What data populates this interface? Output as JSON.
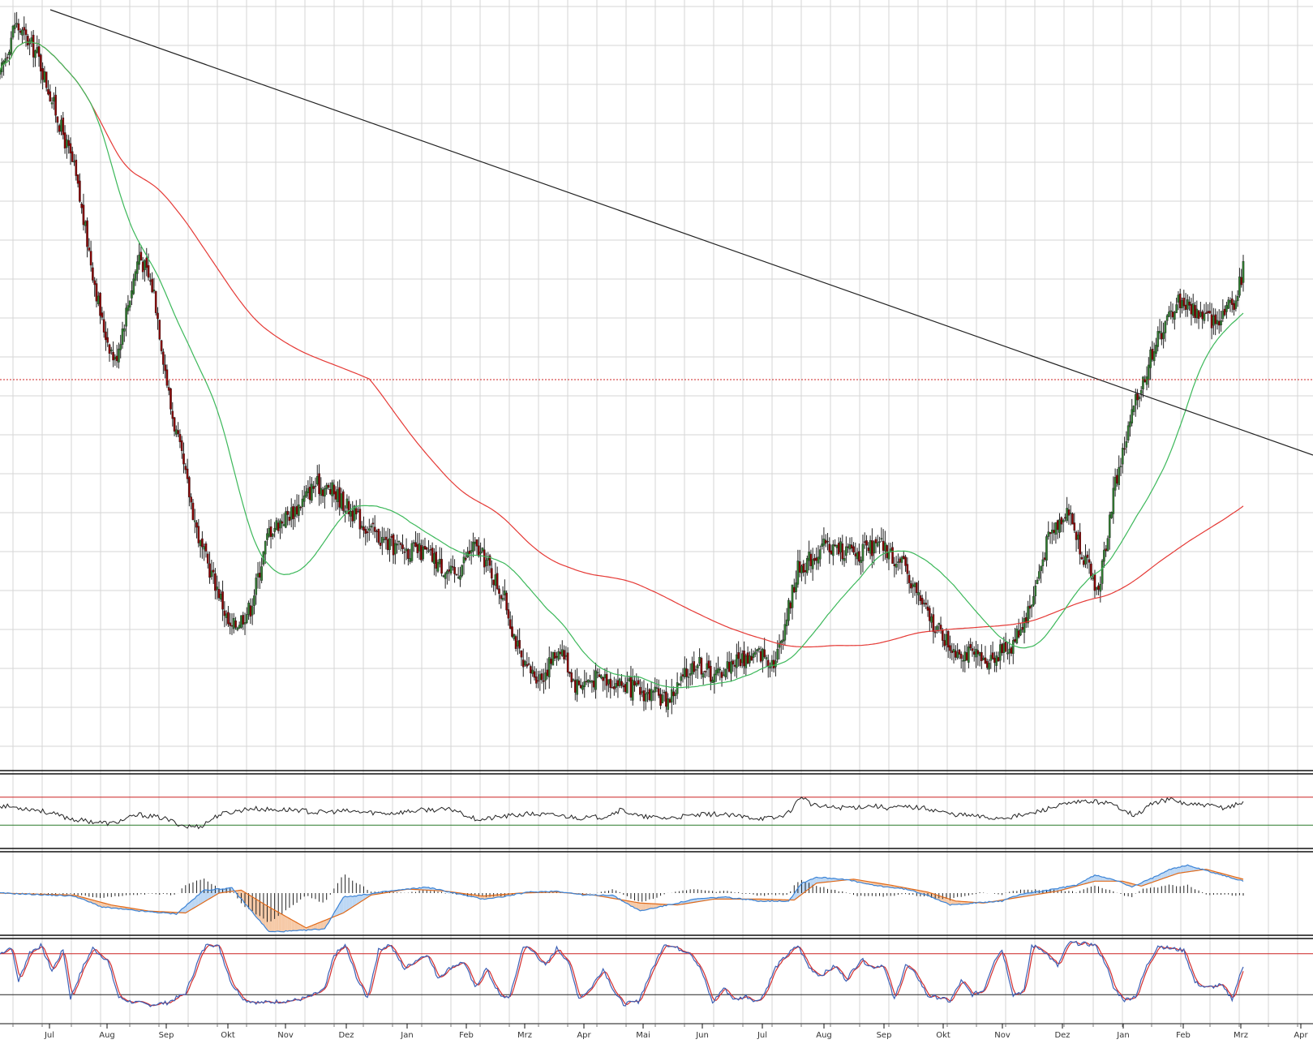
{
  "colors": {
    "grid": "#d6d6d6",
    "candle_up": "#2f7d2f",
    "candle_down": "#8b0000",
    "wick": "#222222",
    "sma_fast": "#3cb85a",
    "sma_slow": "#e53935",
    "trendline": "#222222",
    "level_line": "#cc2222",
    "rsi_line": "#222222",
    "overbought": "#cc2222",
    "oversold": "#2a7a2a",
    "macd_line": "#3b83d6",
    "signal_line": "#e06a1a",
    "macd_fill_pos": "#bcd7f4",
    "macd_fill_neg": "#f6c9a6",
    "histogram": "#222222",
    "stoch_k": "#3b5fb5",
    "stoch_d": "#d32f2f"
  },
  "chart_data": [
    {
      "type": "candlestick",
      "panel": "price",
      "x_ticks": [
        "Jul",
        "Aug",
        "Sep",
        "Okt",
        "Nov",
        "Dez",
        "Jan",
        "Feb",
        "Mrz",
        "Apr",
        "Mai",
        "Jun",
        "Jul",
        "Aug",
        "Sep",
        "Okt",
        "Nov",
        "Dez",
        "Jan",
        "Feb",
        "Mrz",
        "Apr"
      ],
      "ylim": [
        0,
        100
      ],
      "grid": true,
      "close_keypoints": [
        [
          0,
          90
        ],
        [
          8,
          97
        ],
        [
          20,
          93
        ],
        [
          40,
          78
        ],
        [
          55,
          58
        ],
        [
          62,
          53
        ],
        [
          75,
          67
        ],
        [
          83,
          62
        ],
        [
          92,
          47
        ],
        [
          100,
          38
        ],
        [
          108,
          29
        ],
        [
          118,
          23
        ],
        [
          124,
          18
        ],
        [
          135,
          21
        ],
        [
          145,
          31
        ],
        [
          160,
          34
        ],
        [
          170,
          37
        ],
        [
          180,
          36
        ],
        [
          195,
          32
        ],
        [
          210,
          29
        ],
        [
          230,
          28
        ],
        [
          245,
          25
        ],
        [
          255,
          29
        ],
        [
          262,
          27
        ],
        [
          272,
          22
        ],
        [
          282,
          13
        ],
        [
          292,
          12
        ],
        [
          302,
          16
        ],
        [
          310,
          11
        ],
        [
          325,
          12
        ],
        [
          345,
          10
        ],
        [
          360,
          9
        ],
        [
          375,
          14
        ],
        [
          385,
          12
        ],
        [
          395,
          14
        ],
        [
          410,
          15
        ],
        [
          418,
          14
        ],
        [
          430,
          26
        ],
        [
          445,
          29
        ],
        [
          462,
          28
        ],
        [
          475,
          29
        ],
        [
          488,
          26
        ],
        [
          500,
          20
        ],
        [
          512,
          16
        ],
        [
          530,
          14
        ],
        [
          545,
          16
        ],
        [
          555,
          21
        ],
        [
          565,
          30
        ],
        [
          575,
          34
        ],
        [
          585,
          27
        ],
        [
          592,
          23
        ],
        [
          600,
          36
        ],
        [
          610,
          46
        ],
        [
          622,
          55
        ],
        [
          635,
          61
        ],
        [
          648,
          59
        ],
        [
          655,
          58
        ],
        [
          660,
          60
        ],
        [
          666,
          61
        ],
        [
          670,
          65
        ]
      ],
      "sma_fast": "50-day moving average (green)",
      "sma_slow": "200-day moving average (red)",
      "trendline": "descending from the July high through the February highs",
      "horizontal_level": "dotted red resistance line near the latest high"
    },
    {
      "type": "line",
      "panel": "rsi",
      "ylim": [
        0,
        100
      ],
      "levels": [
        70,
        30
      ],
      "keypoints": [
        [
          0,
          58
        ],
        [
          20,
          52
        ],
        [
          40,
          38
        ],
        [
          60,
          32
        ],
        [
          75,
          45
        ],
        [
          88,
          40
        ],
        [
          100,
          28
        ],
        [
          108,
          28
        ],
        [
          118,
          45
        ],
        [
          135,
          54
        ],
        [
          145,
          52
        ],
        [
          160,
          52
        ],
        [
          170,
          48
        ],
        [
          185,
          50
        ],
        [
          200,
          48
        ],
        [
          210,
          47
        ],
        [
          230,
          52
        ],
        [
          245,
          52
        ],
        [
          255,
          40
        ],
        [
          260,
          38
        ],
        [
          270,
          42
        ],
        [
          285,
          46
        ],
        [
          300,
          44
        ],
        [
          315,
          40
        ],
        [
          325,
          42
        ],
        [
          335,
          52
        ],
        [
          345,
          42
        ],
        [
          360,
          40
        ],
        [
          375,
          44
        ],
        [
          385,
          46
        ],
        [
          400,
          42
        ],
        [
          410,
          40
        ],
        [
          418,
          40
        ],
        [
          425,
          48
        ],
        [
          432,
          72
        ],
        [
          438,
          58
        ],
        [
          450,
          55
        ],
        [
          462,
          56
        ],
        [
          470,
          58
        ],
        [
          478,
          55
        ],
        [
          490,
          56
        ],
        [
          500,
          54
        ],
        [
          512,
          46
        ],
        [
          522,
          44
        ],
        [
          535,
          40
        ],
        [
          545,
          42
        ],
        [
          555,
          46
        ],
        [
          565,
          54
        ],
        [
          575,
          60
        ],
        [
          585,
          64
        ],
        [
          595,
          63
        ],
        [
          605,
          54
        ],
        [
          612,
          43
        ],
        [
          620,
          60
        ],
        [
          630,
          67
        ],
        [
          640,
          60
        ],
        [
          650,
          58
        ],
        [
          660,
          55
        ],
        [
          670,
          62
        ]
      ]
    },
    {
      "type": "line",
      "panel": "macd",
      "ylim": [
        -2,
        2
      ],
      "macd_keypoints": [
        [
          0,
          0.0
        ],
        [
          40,
          -0.15
        ],
        [
          55,
          -0.7
        ],
        [
          75,
          -0.9
        ],
        [
          95,
          -1.05
        ],
        [
          110,
          0.15
        ],
        [
          125,
          0.25
        ],
        [
          145,
          -1.95
        ],
        [
          160,
          -1.9
        ],
        [
          175,
          -1.8
        ],
        [
          185,
          -0.2
        ],
        [
          195,
          -0.1
        ],
        [
          210,
          0.1
        ],
        [
          230,
          0.3
        ],
        [
          245,
          0.0
        ],
        [
          260,
          -0.3
        ],
        [
          270,
          -0.2
        ],
        [
          285,
          0.05
        ],
        [
          300,
          0.1
        ],
        [
          315,
          -0.1
        ],
        [
          330,
          -0.1
        ],
        [
          345,
          -0.9
        ],
        [
          360,
          -0.6
        ],
        [
          375,
          -0.3
        ],
        [
          390,
          -0.2
        ],
        [
          410,
          -0.4
        ],
        [
          425,
          -0.4
        ],
        [
          432,
          0.5
        ],
        [
          440,
          0.8
        ],
        [
          455,
          0.7
        ],
        [
          470,
          0.4
        ],
        [
          488,
          0.2
        ],
        [
          500,
          -0.1
        ],
        [
          512,
          -0.6
        ],
        [
          525,
          -0.5
        ],
        [
          540,
          -0.4
        ],
        [
          550,
          -0.05
        ],
        [
          565,
          0.15
        ],
        [
          580,
          0.4
        ],
        [
          590,
          0.9
        ],
        [
          600,
          0.7
        ],
        [
          610,
          0.3
        ],
        [
          622,
          0.8
        ],
        [
          630,
          1.2
        ],
        [
          640,
          1.4
        ],
        [
          655,
          1.0
        ],
        [
          670,
          0.6
        ]
      ],
      "signal_keypoints": [
        [
          0,
          0.0
        ],
        [
          40,
          -0.1
        ],
        [
          60,
          -0.6
        ],
        [
          80,
          -0.9
        ],
        [
          100,
          -1.0
        ],
        [
          118,
          0.0
        ],
        [
          130,
          0.15
        ],
        [
          145,
          -0.7
        ],
        [
          165,
          -1.75
        ],
        [
          185,
          -1.0
        ],
        [
          200,
          -0.1
        ],
        [
          220,
          0.2
        ],
        [
          240,
          0.1
        ],
        [
          260,
          -0.15
        ],
        [
          280,
          0.0
        ],
        [
          300,
          0.05
        ],
        [
          320,
          -0.1
        ],
        [
          345,
          -0.5
        ],
        [
          365,
          -0.6
        ],
        [
          385,
          -0.3
        ],
        [
          410,
          -0.3
        ],
        [
          428,
          -0.35
        ],
        [
          440,
          0.5
        ],
        [
          460,
          0.7
        ],
        [
          480,
          0.4
        ],
        [
          500,
          0.05
        ],
        [
          515,
          -0.4
        ],
        [
          530,
          -0.5
        ],
        [
          550,
          -0.2
        ],
        [
          570,
          0.1
        ],
        [
          590,
          0.6
        ],
        [
          605,
          0.6
        ],
        [
          615,
          0.35
        ],
        [
          635,
          1.0
        ],
        [
          650,
          1.2
        ],
        [
          670,
          0.7
        ]
      ]
    },
    {
      "type": "line",
      "panel": "stochastic",
      "ylim": [
        0,
        100
      ],
      "levels": [
        80,
        20
      ],
      "k_keypoints": [
        [
          0,
          80
        ],
        [
          6,
          90
        ],
        [
          10,
          40
        ],
        [
          16,
          82
        ],
        [
          22,
          92
        ],
        [
          28,
          55
        ],
        [
          34,
          86
        ],
        [
          38,
          15
        ],
        [
          45,
          62
        ],
        [
          50,
          88
        ],
        [
          58,
          70
        ],
        [
          64,
          16
        ],
        [
          70,
          10
        ],
        [
          80,
          5
        ],
        [
          90,
          8
        ],
        [
          100,
          22
        ],
        [
          108,
          78
        ],
        [
          112,
          96
        ],
        [
          118,
          90
        ],
        [
          125,
          35
        ],
        [
          132,
          12
        ],
        [
          140,
          8
        ],
        [
          150,
          10
        ],
        [
          160,
          12
        ],
        [
          168,
          18
        ],
        [
          175,
          28
        ],
        [
          180,
          78
        ],
        [
          186,
          92
        ],
        [
          193,
          40
        ],
        [
          198,
          15
        ],
        [
          204,
          85
        ],
        [
          210,
          94
        ],
        [
          218,
          58
        ],
        [
          224,
          70
        ],
        [
          230,
          80
        ],
        [
          236,
          45
        ],
        [
          244,
          62
        ],
        [
          250,
          68
        ],
        [
          256,
          30
        ],
        [
          262,
          58
        ],
        [
          270,
          16
        ],
        [
          275,
          18
        ],
        [
          282,
          92
        ],
        [
          288,
          82
        ],
        [
          294,
          62
        ],
        [
          300,
          88
        ],
        [
          306,
          70
        ],
        [
          312,
          15
        ],
        [
          318,
          28
        ],
        [
          325,
          58
        ],
        [
          332,
          20
        ],
        [
          336,
          6
        ],
        [
          344,
          10
        ],
        [
          352,
          60
        ],
        [
          358,
          95
        ],
        [
          365,
          88
        ],
        [
          372,
          82
        ],
        [
          378,
          55
        ],
        [
          384,
          8
        ],
        [
          390,
          30
        ],
        [
          396,
          12
        ],
        [
          402,
          18
        ],
        [
          408,
          10
        ],
        [
          412,
          22
        ],
        [
          418,
          60
        ],
        [
          424,
          78
        ],
        [
          430,
          92
        ],
        [
          436,
          60
        ],
        [
          442,
          48
        ],
        [
          450,
          62
        ],
        [
          456,
          42
        ],
        [
          464,
          72
        ],
        [
          470,
          60
        ],
        [
          476,
          64
        ],
        [
          482,
          12
        ],
        [
          488,
          64
        ],
        [
          494,
          48
        ],
        [
          500,
          18
        ],
        [
          506,
          16
        ],
        [
          512,
          10
        ],
        [
          518,
          40
        ],
        [
          524,
          20
        ],
        [
          530,
          26
        ],
        [
          536,
          72
        ],
        [
          540,
          86
        ],
        [
          546,
          20
        ],
        [
          552,
          26
        ],
        [
          556,
          92
        ],
        [
          562,
          86
        ],
        [
          570,
          62
        ],
        [
          576,
          96
        ],
        [
          582,
          95
        ],
        [
          590,
          93
        ],
        [
          596,
          65
        ],
        [
          600,
          30
        ],
        [
          606,
          12
        ],
        [
          612,
          18
        ],
        [
          618,
          62
        ],
        [
          624,
          92
        ],
        [
          630,
          88
        ],
        [
          638,
          85
        ],
        [
          644,
          38
        ],
        [
          650,
          30
        ],
        [
          658,
          34
        ],
        [
          664,
          14
        ],
        [
          670,
          62
        ]
      ]
    }
  ]
}
